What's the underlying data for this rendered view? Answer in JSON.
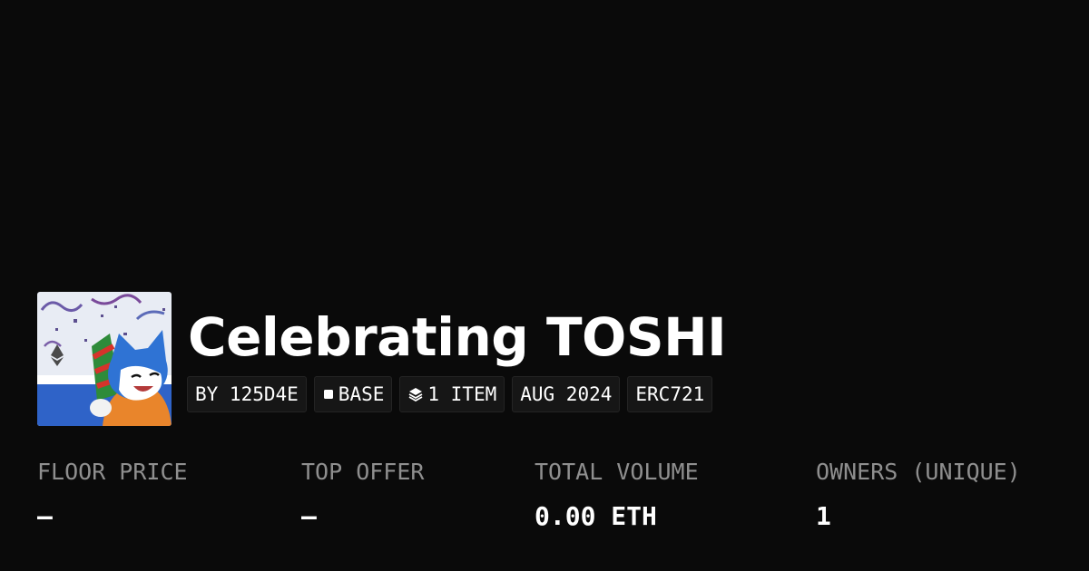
{
  "collection": {
    "title": "Celebrating TOSHI",
    "avatar_icon": "toshi-cat-party-popper-image"
  },
  "chips": {
    "creator": "BY 125D4E",
    "chain": "BASE",
    "chain_icon": "square-icon",
    "items": "1 ITEM",
    "items_icon": "layers-icon",
    "date": "AUG 2024",
    "standard": "ERC721"
  },
  "stats": {
    "floor_price": {
      "label": "FLOOR PRICE",
      "value": "–"
    },
    "top_offer": {
      "label": "TOP OFFER",
      "value": "–"
    },
    "total_volume": {
      "label": "TOTAL VOLUME",
      "value": "0.00 ETH"
    },
    "owners": {
      "label": "OWNERS (UNIQUE)",
      "value": "1"
    }
  },
  "colors": {
    "background": "#0a0a0a",
    "chip_background": "#161616",
    "label": "#8f8f8f",
    "text": "#ffffff"
  }
}
